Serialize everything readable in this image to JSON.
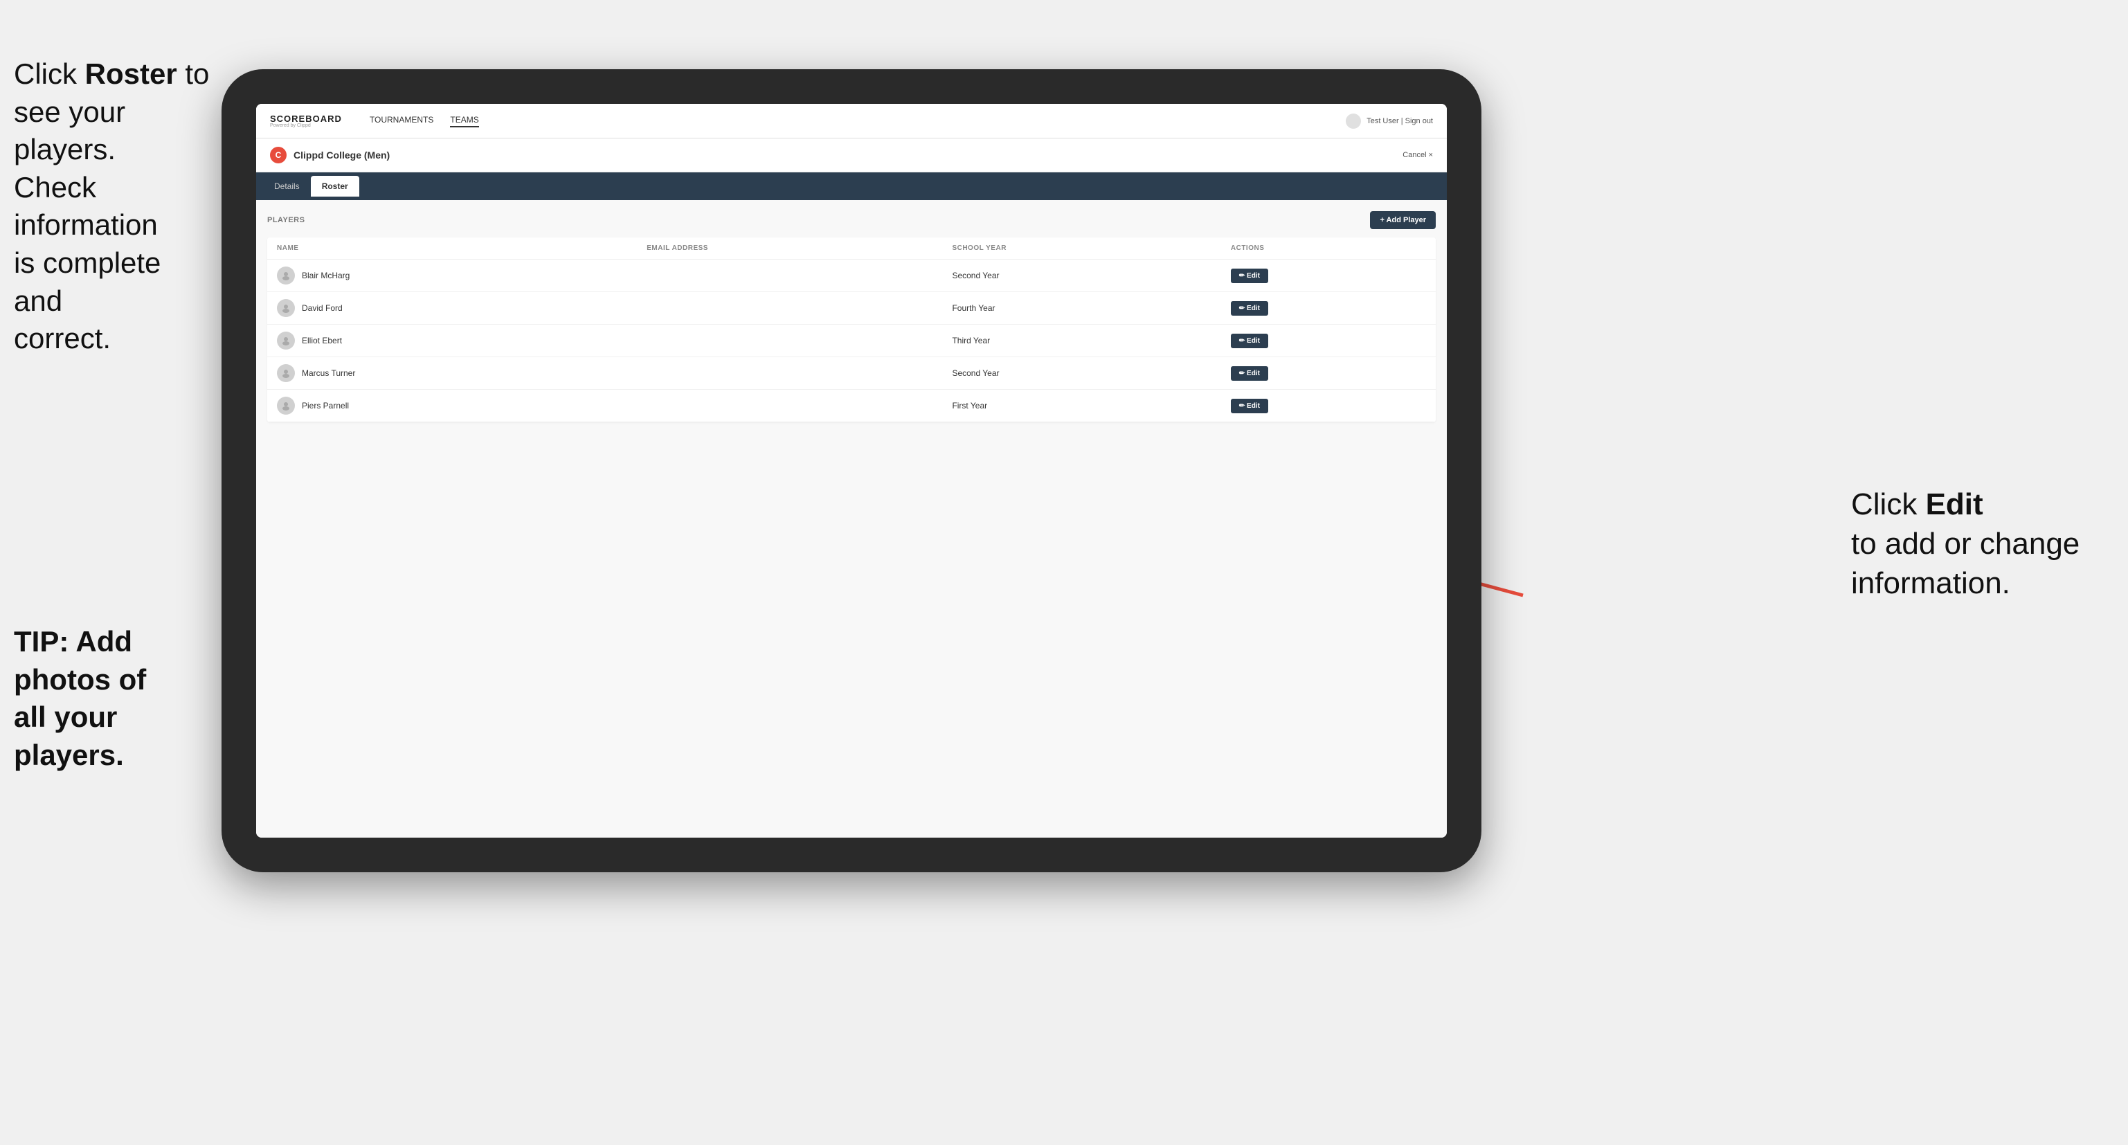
{
  "instructions": {
    "left_top_line1": "Click ",
    "left_top_bold": "Roster",
    "left_top_line2": " to",
    "left_top_rest": "see your players.\nCheck information\nis complete and\ncorrect.",
    "tip_label": "TIP: Add photos of\nall your players.",
    "right_bold": "Edit",
    "right_rest": "to add or change\ninformation.",
    "right_prefix": "Click "
  },
  "nav": {
    "logo_main": "SCOREBOARD",
    "logo_sub": "Powered by Clippd",
    "links": [
      {
        "label": "TOURNAMENTS",
        "active": false
      },
      {
        "label": "TEAMS",
        "active": true
      }
    ],
    "user_text": "Test User | Sign out"
  },
  "team": {
    "logo_letter": "C",
    "name": "Clippd College (Men)",
    "cancel_label": "Cancel ×"
  },
  "tabs": [
    {
      "label": "Details",
      "active": false
    },
    {
      "label": "Roster",
      "active": true
    }
  ],
  "players_section": {
    "label": "PLAYERS",
    "add_button": "+ Add Player",
    "columns": [
      {
        "label": "NAME"
      },
      {
        "label": "EMAIL ADDRESS"
      },
      {
        "label": "SCHOOL YEAR"
      },
      {
        "label": "ACTIONS"
      }
    ],
    "players": [
      {
        "name": "Blair McHarg",
        "email": "",
        "school_year": "Second Year"
      },
      {
        "name": "David Ford",
        "email": "",
        "school_year": "Fourth Year"
      },
      {
        "name": "Elliot Ebert",
        "email": "",
        "school_year": "Third Year"
      },
      {
        "name": "Marcus Turner",
        "email": "",
        "school_year": "Second Year"
      },
      {
        "name": "Piers Parnell",
        "email": "",
        "school_year": "First Year"
      }
    ],
    "edit_button": "✏ Edit"
  }
}
